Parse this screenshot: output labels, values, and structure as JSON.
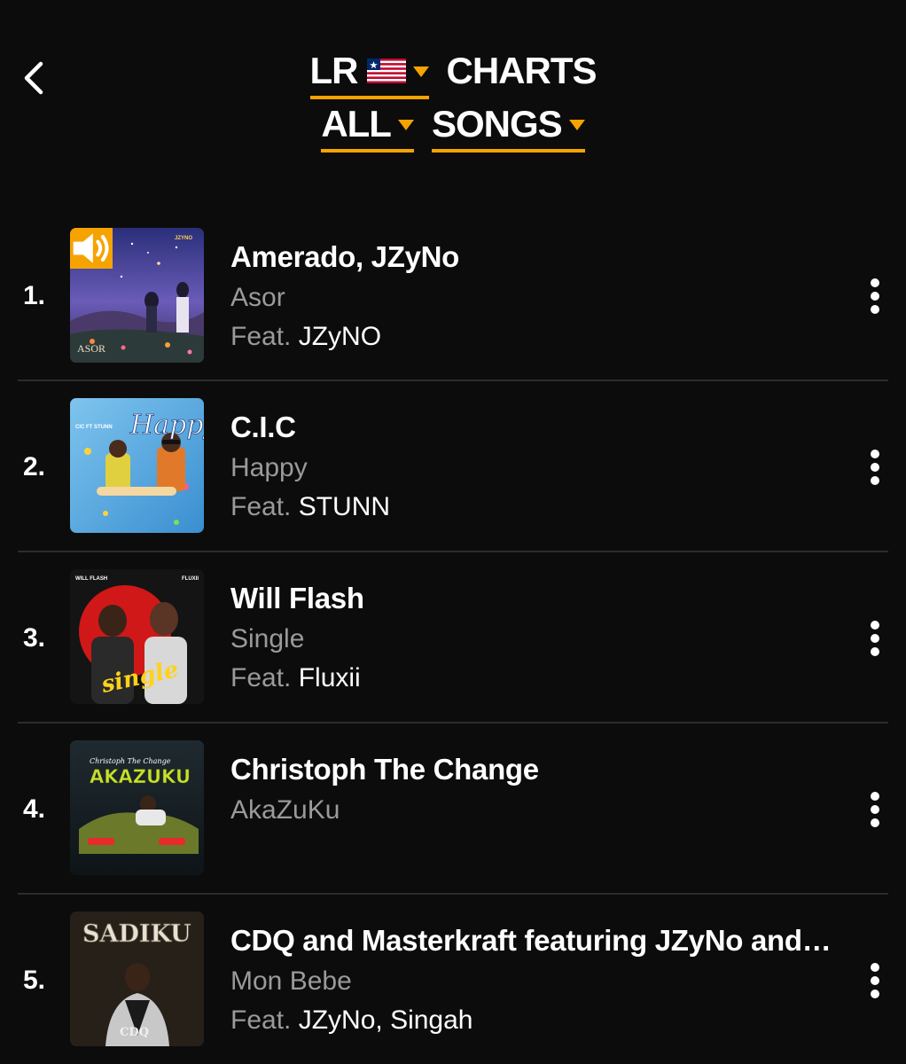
{
  "header": {
    "back_icon": "chevron-left-icon",
    "country_code": "LR",
    "country_flag": "liberia-flag-icon",
    "charts_label": "CHARTS",
    "genre_label": "ALL",
    "type_label": "SONGS",
    "accent_color": "#f6a300"
  },
  "tracks": [
    {
      "rank": "1.",
      "title": "Amerado, JZyNo",
      "subtitle": "Asor",
      "feat_prefix": "Feat.",
      "feat": "JZyNO",
      "art_text": "ASOR",
      "art_tag": "JZYNO",
      "now_playing_icon": "speaker-icon"
    },
    {
      "rank": "2.",
      "title": "C.I.C",
      "subtitle": "Happy",
      "feat_prefix": "Feat.",
      "feat": "STUNN",
      "art_text": "Happy",
      "art_tag": "CIC FT STUNN"
    },
    {
      "rank": "3.",
      "title": "Will Flash",
      "subtitle": "Single",
      "feat_prefix": "Feat.",
      "feat": "Fluxii",
      "art_text": "single",
      "art_tag_left": "WILL FLASH",
      "art_tag_right": "FLUXII"
    },
    {
      "rank": "4.",
      "title": "Christoph The Change",
      "subtitle": "AkaZuKu",
      "art_text": "AKAZUKU",
      "art_tag": "Christoph The Change"
    },
    {
      "rank": "5.",
      "title": "CDQ and Masterkraft featuring JZyNo and Singah",
      "subtitle": "Mon Bebe",
      "feat_prefix": "Feat.",
      "feat": "JZyNo, Singah",
      "art_text": "SADIKU",
      "art_tag": "CDQ"
    }
  ]
}
